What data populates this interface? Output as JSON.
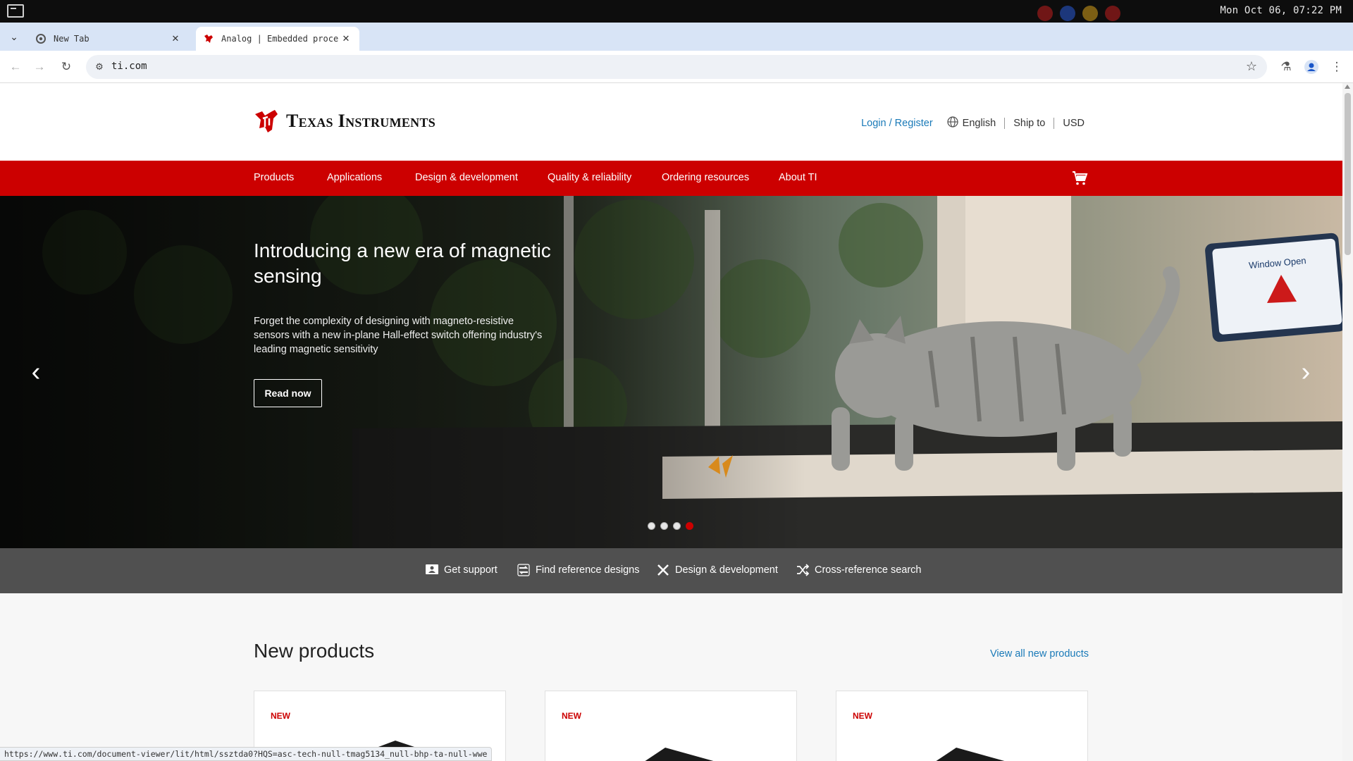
{
  "os": {
    "clock": "Mon Oct 06, 07:22 PM"
  },
  "browser": {
    "tabs": [
      {
        "title": "New Tab"
      },
      {
        "title": "Analog | Embedded proce"
      }
    ],
    "url": "ti.com",
    "status_url": "https://www.ti.com/document-viewer/lit/html/ssztda0?HQS=asc-tech-null-tmag5134_null-bhp-ta-null-wwe"
  },
  "header": {
    "logo_text": "Texas Instruments",
    "login": "Login / Register",
    "language": "English",
    "ship_to": "Ship to",
    "currency": "USD"
  },
  "nav": {
    "items": [
      "Products",
      "Applications",
      "Design & development",
      "Quality & reliability",
      "Ordering resources",
      "About TI"
    ]
  },
  "hero": {
    "title": "Introducing a new era of magnetic sensing",
    "description": "Forget the complexity of designing with magneto-resistive sensors with a new in-plane Hall-effect switch offering industry's leading magnetic sensitivity",
    "cta": "Read now",
    "slide_count": 4,
    "active_slide": 4,
    "tablet_heading": "Window Open"
  },
  "quick_links": [
    "Get support",
    "Find reference designs",
    "Design & development",
    "Cross-reference search"
  ],
  "new_products": {
    "title": "New products",
    "view_all": "View all new products",
    "cards": [
      {
        "badge": "NEW"
      },
      {
        "badge": "NEW"
      },
      {
        "badge": "NEW"
      }
    ]
  },
  "colors": {
    "brand_red": "#cc0000",
    "link_blue": "#1a7ab8",
    "quick_bar": "#505050"
  }
}
